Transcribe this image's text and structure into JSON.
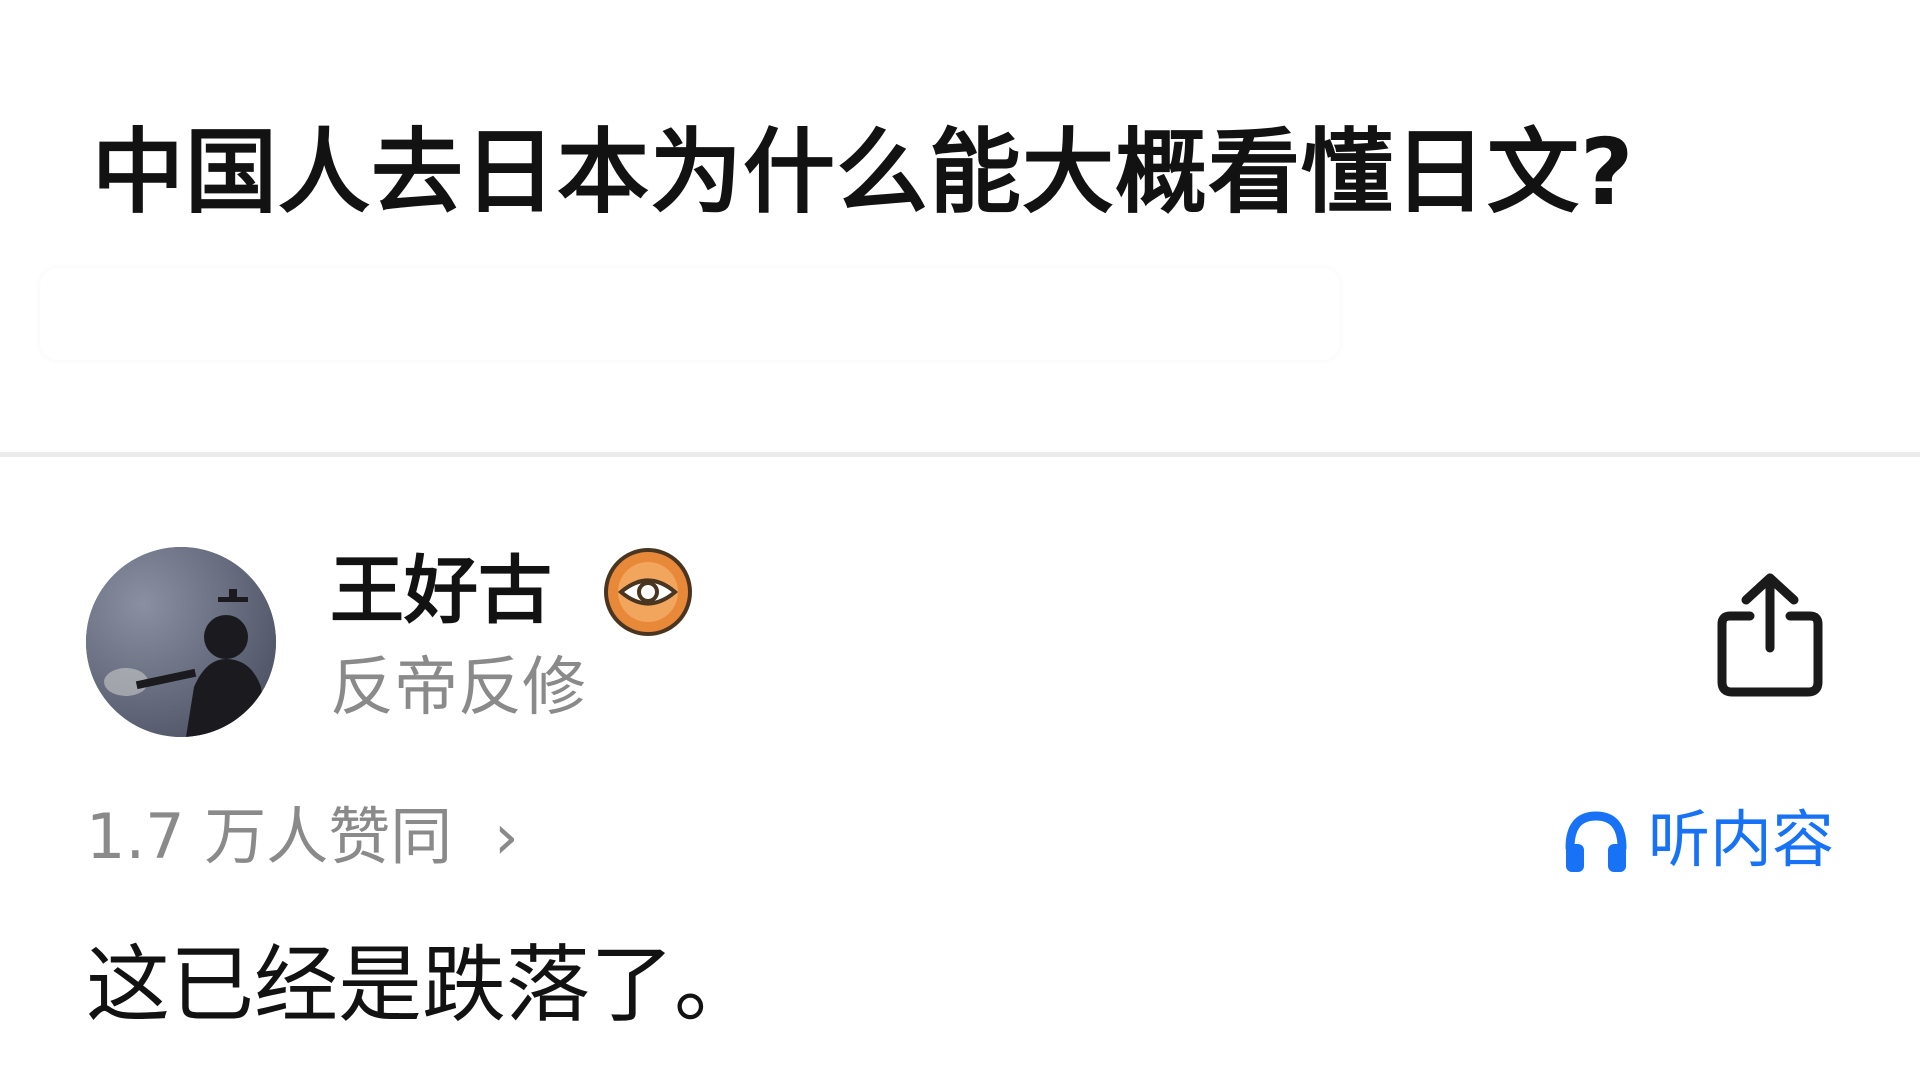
{
  "question": {
    "title": "中国人去日本为什么能大概看懂日文?"
  },
  "answer": {
    "author": {
      "name": "王好古",
      "bio": "反帝反修",
      "avatar_icon": "avatar-silhouette",
      "badge_icon": "eye-badge-icon"
    },
    "votes_label": "1.7 万人赞同",
    "votes_chevron": "›",
    "listen_label": "听内容",
    "listen_icon": "headphones-icon",
    "share_icon": "share-icon",
    "text": "这已经是跌落了。"
  },
  "colors": {
    "accent": "#1772f6",
    "muted_text": "#8a8a8a",
    "badge_orange": "#e8893a",
    "divider": "#ebebeb"
  }
}
